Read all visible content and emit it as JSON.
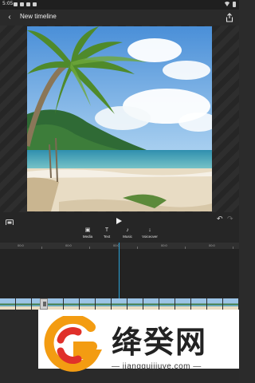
{
  "status_bar": {
    "time": "5:05"
  },
  "header": {
    "title": "New timeline"
  },
  "toolbar": {
    "tools": [
      {
        "label": "Media",
        "icon": "image-icon"
      },
      {
        "label": "Text",
        "icon": "text-icon"
      },
      {
        "label": "Music",
        "icon": "music-note-icon"
      },
      {
        "label": "Voiceover",
        "icon": "microphone-icon"
      }
    ]
  },
  "ruler": {
    "ticks": [
      "00:0",
      "00:0",
      "00:0",
      "00:0",
      "00:0"
    ]
  },
  "watermark": {
    "brand": "绛癸网",
    "url": "jiangguijiuye.com"
  },
  "colors": {
    "background": "#2b2b2b",
    "playhead": "#2aa3d8",
    "logo_orange": "#f39c12",
    "logo_red": "#e0302a"
  }
}
